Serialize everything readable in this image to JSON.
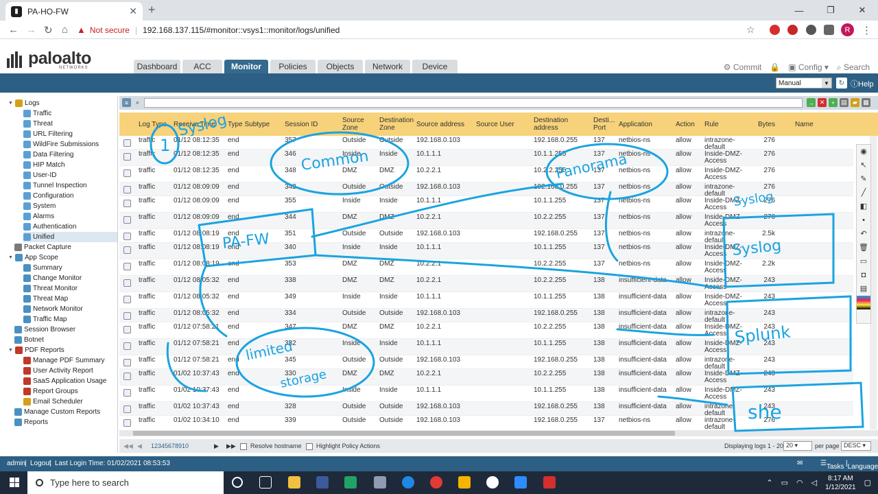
{
  "browser": {
    "tab_title": "PA-HO-FW",
    "security_label": "Not secure",
    "url": "192.168.137.115/#monitor::vsys1::monitor/logs/unified",
    "profile_initial": "R"
  },
  "header": {
    "brand": "paloalto",
    "brand_sub": "NETWORKS",
    "tabs": [
      {
        "label": "Dashboard"
      },
      {
        "label": "ACC"
      },
      {
        "label": "Monitor",
        "active": true
      },
      {
        "label": "Policies"
      },
      {
        "label": "Objects"
      },
      {
        "label": "Network"
      },
      {
        "label": "Device"
      }
    ],
    "actions": {
      "commit": "Commit",
      "config": "Config",
      "search": "Search"
    },
    "refresh_mode": "Manual",
    "help": "Help"
  },
  "sidebar": {
    "items": [
      {
        "label": "Logs",
        "level": 0,
        "twisty": "▼",
        "icon": "#d4a017"
      },
      {
        "label": "Traffic",
        "level": 1,
        "icon": "#5aa0d6"
      },
      {
        "label": "Threat",
        "level": 1,
        "icon": "#5aa0d6"
      },
      {
        "label": "URL Filtering",
        "level": 1,
        "icon": "#5aa0d6"
      },
      {
        "label": "WildFire Submissions",
        "level": 1,
        "icon": "#5aa0d6"
      },
      {
        "label": "Data Filtering",
        "level": 1,
        "icon": "#5aa0d6"
      },
      {
        "label": "HIP Match",
        "level": 1,
        "icon": "#5aa0d6"
      },
      {
        "label": "User-ID",
        "level": 1,
        "icon": "#5aa0d6"
      },
      {
        "label": "Tunnel Inspection",
        "level": 1,
        "icon": "#5aa0d6"
      },
      {
        "label": "Configuration",
        "level": 1,
        "icon": "#5aa0d6"
      },
      {
        "label": "System",
        "level": 1,
        "icon": "#5aa0d6"
      },
      {
        "label": "Alarms",
        "level": 1,
        "icon": "#5aa0d6"
      },
      {
        "label": "Authentication",
        "level": 1,
        "icon": "#5aa0d6"
      },
      {
        "label": "Unified",
        "level": 1,
        "icon": "#5aa0d6",
        "selected": true
      },
      {
        "label": "Packet Capture",
        "level": 0,
        "icon": "#7a7a7a"
      },
      {
        "label": "App Scope",
        "level": 0,
        "twisty": "▼",
        "icon": "#4a90c2"
      },
      {
        "label": "Summary",
        "level": 1,
        "icon": "#4a90c2"
      },
      {
        "label": "Change Monitor",
        "level": 1,
        "icon": "#4a90c2"
      },
      {
        "label": "Threat Monitor",
        "level": 1,
        "icon": "#4a90c2"
      },
      {
        "label": "Threat Map",
        "level": 1,
        "icon": "#4a90c2"
      },
      {
        "label": "Network Monitor",
        "level": 1,
        "icon": "#4a90c2"
      },
      {
        "label": "Traffic Map",
        "level": 1,
        "icon": "#4a90c2"
      },
      {
        "label": "Session Browser",
        "level": 0,
        "icon": "#4a90c2"
      },
      {
        "label": "Botnet",
        "level": 0,
        "icon": "#4a90c2"
      },
      {
        "label": "PDF Reports",
        "level": 0,
        "twisty": "▼",
        "icon": "#c0392b"
      },
      {
        "label": "Manage PDF Summary",
        "level": 1,
        "icon": "#c0392b"
      },
      {
        "label": "User Activity Report",
        "level": 1,
        "icon": "#c0392b"
      },
      {
        "label": "SaaS Application Usage",
        "level": 1,
        "icon": "#c0392b"
      },
      {
        "label": "Report Groups",
        "level": 1,
        "icon": "#c0392b"
      },
      {
        "label": "Email Scheduler",
        "level": 1,
        "icon": "#d4a017"
      },
      {
        "label": "Manage Custom Reports",
        "level": 0,
        "icon": "#4a90c2"
      },
      {
        "label": "Reports",
        "level": 0,
        "icon": "#4a90c2"
      }
    ]
  },
  "table": {
    "columns": [
      {
        "key": "log_type",
        "label": "Log Type"
      },
      {
        "key": "receive_time",
        "label": "Receive Time"
      },
      {
        "key": "subtype",
        "label": "Type Subtype"
      },
      {
        "key": "session_id",
        "label": "Session ID"
      },
      {
        "key": "src_zone",
        "label": "Source Zone"
      },
      {
        "key": "dst_zone",
        "label": "Destination Zone"
      },
      {
        "key": "src_addr",
        "label": "Source address"
      },
      {
        "key": "src_user",
        "label": "Source User"
      },
      {
        "key": "dst_addr",
        "label": "Destination address"
      },
      {
        "key": "dst_port",
        "label": "Desti... Port"
      },
      {
        "key": "application",
        "label": "Application"
      },
      {
        "key": "action",
        "label": "Action"
      },
      {
        "key": "rule",
        "label": "Rule"
      },
      {
        "key": "bytes",
        "label": "Bytes"
      },
      {
        "key": "name",
        "label": "Name"
      }
    ],
    "rows": [
      [
        "traffic",
        "01/12 08:12:35",
        "end",
        "357",
        "Outside",
        "Outside",
        "192.168.0.103",
        "",
        "192.168.0.255",
        "137",
        "netbios-ns",
        "allow",
        "intrazone-default",
        "276",
        ""
      ],
      [
        "traffic",
        "01/12 08:12:35",
        "end",
        "346",
        "Inside",
        "Inside",
        "10.1.1.1",
        "",
        "10.1.1.255",
        "137",
        "netbios-ns",
        "allow",
        "Inside-DMZ-Access",
        "276",
        ""
      ],
      [
        "traffic",
        "01/12 08:12:35",
        "end",
        "348",
        "DMZ",
        "DMZ",
        "10.2.2.1",
        "",
        "10.2.2.255",
        "137",
        "netbios-ns",
        "allow",
        "Inside-DMZ-Access",
        "276",
        ""
      ],
      [
        "traffic",
        "01/12 08:09:09",
        "end",
        "342",
        "Outside",
        "Outside",
        "192.168.0.103",
        "",
        "192.168.0.255",
        "137",
        "netbios-ns",
        "allow",
        "intrazone-default",
        "276",
        ""
      ],
      [
        "traffic",
        "01/12 08:09:09",
        "end",
        "355",
        "Inside",
        "Inside",
        "10.1.1.1",
        "",
        "10.1.1.255",
        "137",
        "netbios-ns",
        "allow",
        "Inside-DMZ-Access",
        "276",
        ""
      ],
      [
        "traffic",
        "01/12 08:09:09",
        "end",
        "344",
        "DMZ",
        "DMZ",
        "10.2.2.1",
        "",
        "10.2.2.255",
        "137",
        "netbios-ns",
        "allow",
        "Inside-DMZ-Access",
        "276",
        ""
      ],
      [
        "traffic",
        "01/12 08:08:19",
        "end",
        "351",
        "Outside",
        "Outside",
        "192.168.0.103",
        "",
        "192.168.0.255",
        "137",
        "netbios-ns",
        "allow",
        "intrazone-default",
        "2.5k",
        ""
      ],
      [
        "traffic",
        "01/12 08:08:19",
        "end",
        "340",
        "Inside",
        "Inside",
        "10.1.1.1",
        "",
        "10.1.1.255",
        "137",
        "netbios-ns",
        "allow",
        "Inside-DMZ-Access",
        "",
        ""
      ],
      [
        "traffic",
        "01/12 08:08:19",
        "end",
        "353",
        "DMZ",
        "DMZ",
        "10.2.2.1",
        "",
        "10.2.2.255",
        "137",
        "netbios-ns",
        "allow",
        "Inside-DMZ-Access",
        "2.2k",
        ""
      ],
      [
        "traffic",
        "01/12 08:05:32",
        "end",
        "338",
        "DMZ",
        "DMZ",
        "10.2.2.1",
        "",
        "10.2.2.255",
        "138",
        "insufficient-data",
        "allow",
        "Inside-DMZ-Access",
        "243",
        ""
      ],
      [
        "traffic",
        "01/12 08:05:32",
        "end",
        "349",
        "Inside",
        "Inside",
        "10.1.1.1",
        "",
        "10.1.1.255",
        "138",
        "insufficient-data",
        "allow",
        "Inside-DMZ-Access",
        "243",
        ""
      ],
      [
        "traffic",
        "01/12 08:05:32",
        "end",
        "334",
        "Outside",
        "Outside",
        "192.168.0.103",
        "",
        "192.168.0.255",
        "138",
        "insufficient-data",
        "allow",
        "intrazone-default",
        "243",
        ""
      ],
      [
        "traffic",
        "01/12 07:58:21",
        "end",
        "347",
        "DMZ",
        "DMZ",
        "10.2.2.1",
        "",
        "10.2.2.255",
        "138",
        "insufficient-data",
        "allow",
        "Inside-DMZ-Access",
        "243",
        ""
      ],
      [
        "traffic",
        "01/12 07:58:21",
        "end",
        "332",
        "Inside",
        "Inside",
        "10.1.1.1",
        "",
        "10.1.1.255",
        "138",
        "insufficient-data",
        "allow",
        "Inside-DMZ-Access",
        "243",
        ""
      ],
      [
        "traffic",
        "01/12 07:58:21",
        "end",
        "345",
        "Outside",
        "Outside",
        "192.168.0.103",
        "",
        "192.168.0.255",
        "138",
        "insufficient-data",
        "allow",
        "intrazone-default",
        "243",
        ""
      ],
      [
        "traffic",
        "01/02 10:37:43",
        "end",
        "330",
        "DMZ",
        "DMZ",
        "10.2.2.1",
        "",
        "10.2.2.255",
        "138",
        "insufficient-data",
        "allow",
        "Inside-DMZ-Access",
        "243",
        ""
      ],
      [
        "traffic",
        "01/02 10:37:43",
        "end",
        "",
        "Inside",
        "Inside",
        "10.1.1.1",
        "",
        "10.1.1.255",
        "138",
        "insufficient-data",
        "allow",
        "Inside-DMZ-Access",
        "243",
        ""
      ],
      [
        "traffic",
        "01/02 10:37:43",
        "end",
        "328",
        "Outside",
        "Outside",
        "192.168.0.103",
        "",
        "192.168.0.255",
        "138",
        "insufficient-data",
        "allow",
        "intrazone-default",
        "243",
        ""
      ],
      [
        "traffic",
        "01/02 10:34:10",
        "end",
        "339",
        "Outside",
        "Outside",
        "192.168.0.103",
        "",
        "192.168.0.255",
        "137",
        "netbios-ns",
        "allow",
        "intrazone-default",
        "276",
        ""
      ]
    ]
  },
  "pager": {
    "pages": "12345678910",
    "resolve_hostname": "Resolve hostname",
    "highlight_policy": "Highlight Policy Actions",
    "displaying": "Displaying logs 1 - 20",
    "per_page_value": "20",
    "per_page_label": "per page",
    "order": "DESC"
  },
  "status": {
    "user": "admin",
    "logout": "Logout",
    "last_login": "Last Login Time: 01/02/2021 08:53:53",
    "tasks": "Tasks",
    "language": "Language"
  },
  "taskbar": {
    "search_placeholder": "Type here to search",
    "time": "8:17 AM",
    "date": "1/12/2021"
  },
  "annotations": {
    "syslog": "Syslog",
    "common": "Common",
    "panorama": "Panorama",
    "pa_fw": "PA-FW",
    "limited_storage": "limited",
    "storage": "storage",
    "siem_syslog": "Syslog",
    "splunk": "Splunk",
    "she": "she",
    "one": "1"
  },
  "colors": {
    "accent": "#2c5f83",
    "table_header": "#f7d27a",
    "annotation": "#1aa3e0"
  }
}
